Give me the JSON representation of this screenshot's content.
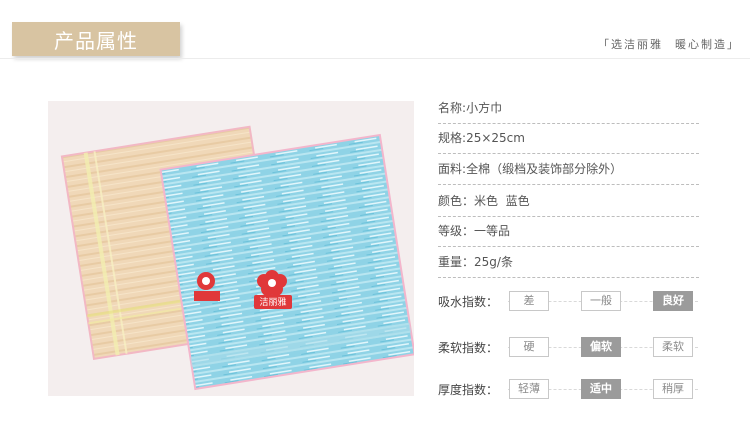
{
  "header": {
    "title": "产品属性",
    "slogan_left": "「选洁丽雅",
    "slogan_right": "暖心制造」"
  },
  "photo": {
    "brand_label": "洁丽雅"
  },
  "attributes": [
    {
      "label": "名称",
      "sep": ":",
      "value": "小方巾"
    },
    {
      "label": "规格",
      "sep": ":",
      "value": "25×25cm"
    },
    {
      "label": "面料",
      "sep": ":",
      "value": "全棉（缎档及装饰部分除外）"
    },
    {
      "label": "颜色",
      "sep": "：",
      "value": "米色  蓝色"
    },
    {
      "label": "等级",
      "sep": "：",
      "value": "一等品"
    },
    {
      "label": "重量",
      "sep": "：",
      "value": "25g/条"
    }
  ],
  "indices": [
    {
      "label": "吸水指数：",
      "options": [
        "差",
        "一般",
        "良好"
      ],
      "selected": "良好"
    },
    {
      "label": "柔软指数：",
      "options": [
        "硬",
        "偏软",
        "柔软"
      ],
      "selected": "偏软"
    },
    {
      "label": "厚度指数：",
      "options": [
        "轻薄",
        "适中",
        "稍厚"
      ],
      "selected": "适中"
    }
  ]
}
